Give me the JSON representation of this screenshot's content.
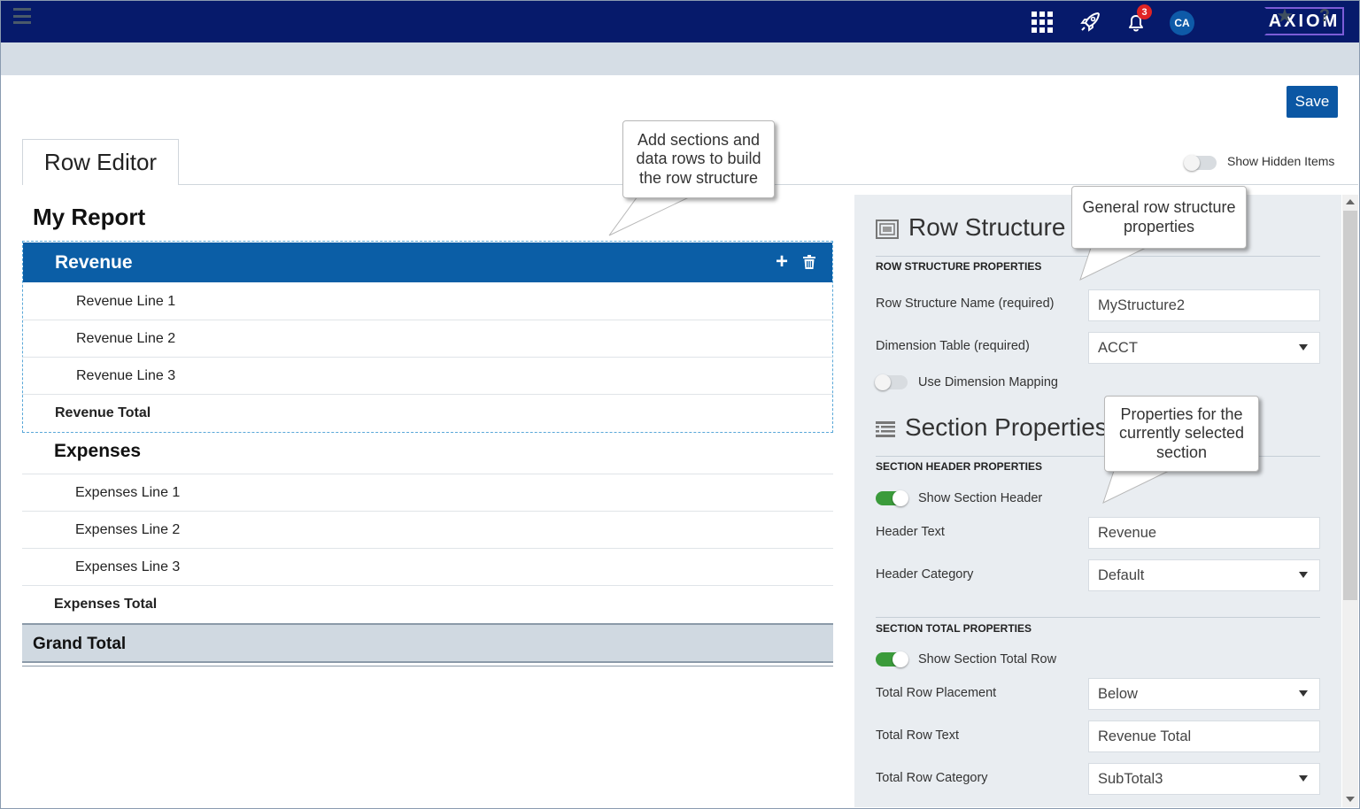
{
  "topbar": {
    "notification_count": "3",
    "avatar_initials": "CA",
    "logo": "AXIOM"
  },
  "toolbar": {
    "save_label": "Save"
  },
  "tab": {
    "label": "Row Editor"
  },
  "show_hidden": {
    "label": "Show Hidden Items",
    "on": false
  },
  "report": {
    "title": "My Report",
    "sections": [
      {
        "header": "Revenue",
        "lines": [
          "Revenue Line 1",
          "Revenue Line 2",
          "Revenue Line 3"
        ],
        "total": "Revenue Total"
      },
      {
        "header": "Expenses",
        "lines": [
          "Expenses Line 1",
          "Expenses Line 2",
          "Expenses Line 3"
        ],
        "total": "Expenses Total"
      }
    ],
    "grand_total": "Grand Total"
  },
  "panel": {
    "row_structure": {
      "title": "Row Structure",
      "subheading": "ROW STRUCTURE PROPERTIES",
      "name_label": "Row Structure Name (required)",
      "name_value": "MyStructure2",
      "dimension_label": "Dimension Table (required)",
      "dimension_value": "ACCT",
      "mapping_label": "Use Dimension Mapping"
    },
    "section_properties": {
      "title": "Section Properties",
      "header_subheading": "SECTION HEADER PROPERTIES",
      "show_header_label": "Show Section Header",
      "header_text_label": "Header Text",
      "header_text_value": "Revenue",
      "header_category_label": "Header Category",
      "header_category_value": "Default",
      "total_subheading": "SECTION TOTAL PROPERTIES",
      "show_total_label": "Show Section Total Row",
      "placement_label": "Total Row Placement",
      "placement_value": "Below",
      "total_text_label": "Total Row Text",
      "total_text_value": "Revenue Total",
      "total_category_label": "Total Row Category",
      "total_category_value": "SubTotal3"
    }
  },
  "callouts": {
    "add_sections": "Add sections and data rows to build the row structure",
    "general": "General row structure properties",
    "properties": "Properties for the currently selected section"
  },
  "colors": {
    "topbar": "#061a6b",
    "accent": "#0b5ea6",
    "toggle_on": "#3b9b3b"
  }
}
